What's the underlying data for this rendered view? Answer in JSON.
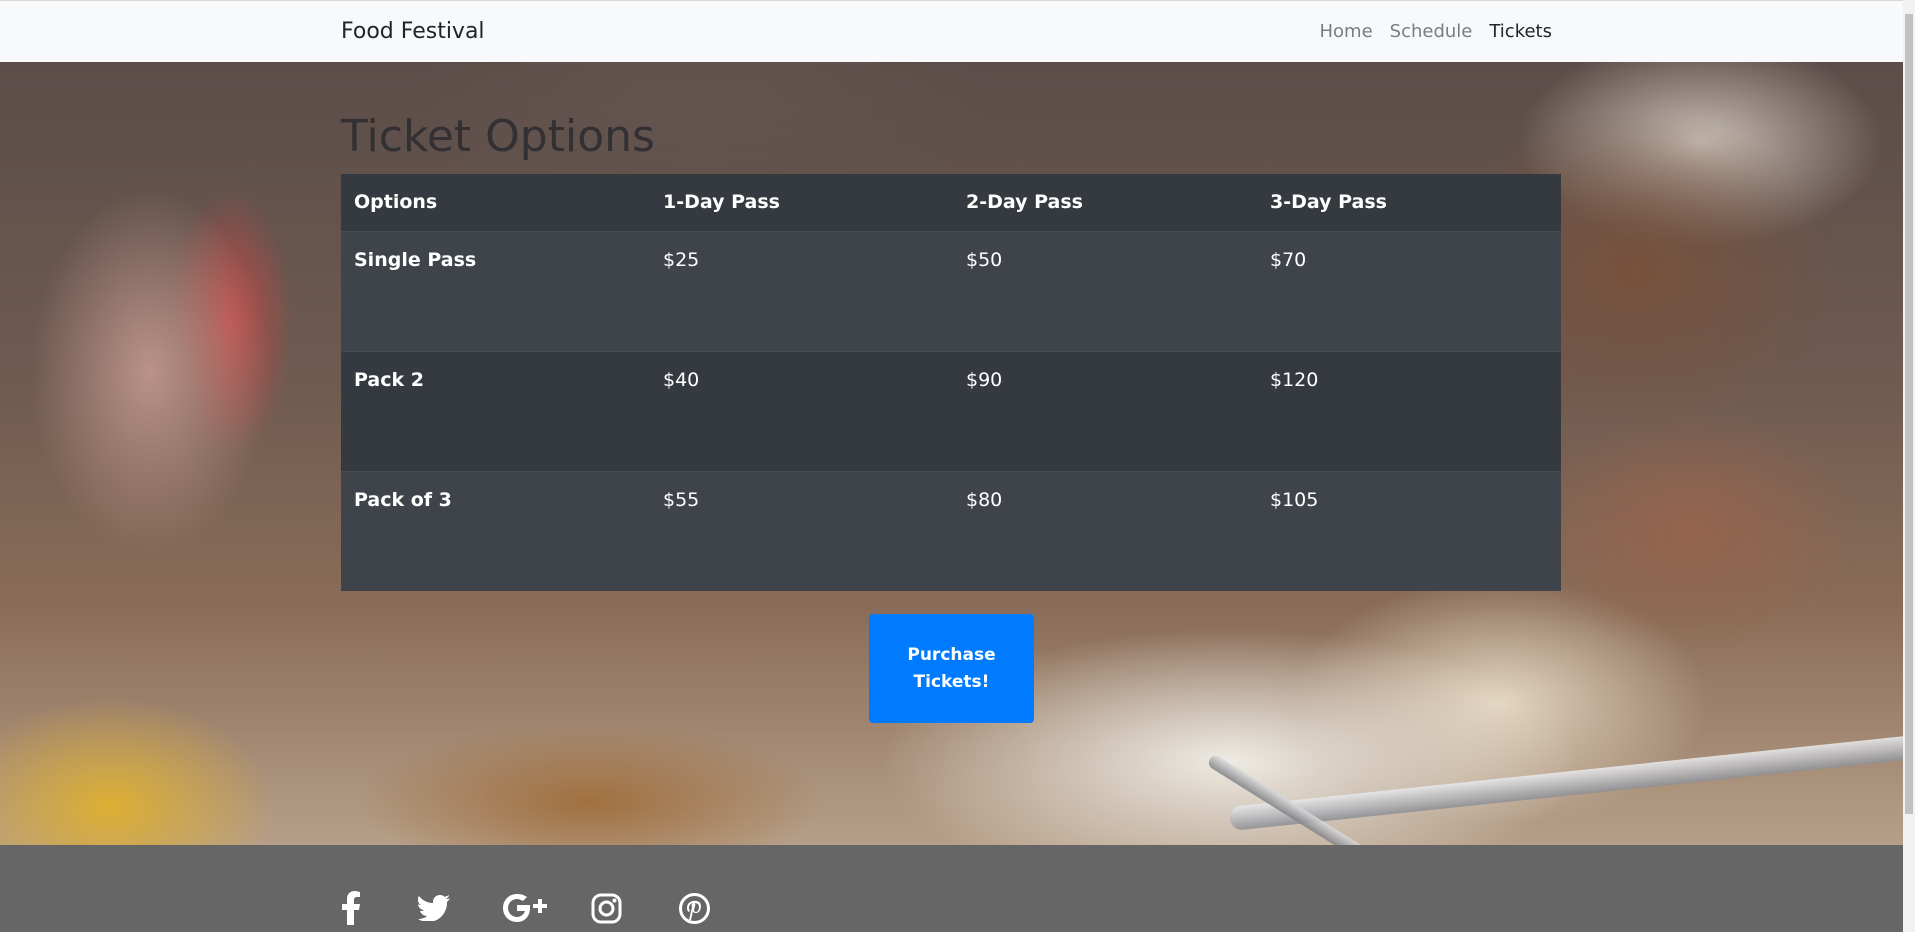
{
  "navbar": {
    "brand": "Food Festival",
    "links": [
      {
        "label": "Home",
        "active": false
      },
      {
        "label": "Schedule",
        "active": false
      },
      {
        "label": "Tickets",
        "active": true
      }
    ]
  },
  "main": {
    "heading": "Ticket Options",
    "table": {
      "headers": [
        "Options",
        "1-Day Pass",
        "2-Day Pass",
        "3-Day Pass"
      ],
      "rows": [
        [
          "Single Pass",
          "$25",
          "$50",
          "$70"
        ],
        [
          "Pack 2",
          "$40",
          "$90",
          "$120"
        ],
        [
          "Pack of 3",
          "$55",
          "$80",
          "$105"
        ]
      ]
    },
    "purchase_button": "Purchase Tickets!"
  },
  "footer": {
    "social_icons": [
      "facebook-icon",
      "twitter-icon",
      "google-plus-icon",
      "instagram-icon",
      "pinterest-icon"
    ]
  },
  "colors": {
    "navbar_bg": "#f8f9fa",
    "table_dark": "#343a40",
    "table_stripe": "#3e444a",
    "button_primary": "#007bff",
    "footer_bg": "#666666"
  }
}
